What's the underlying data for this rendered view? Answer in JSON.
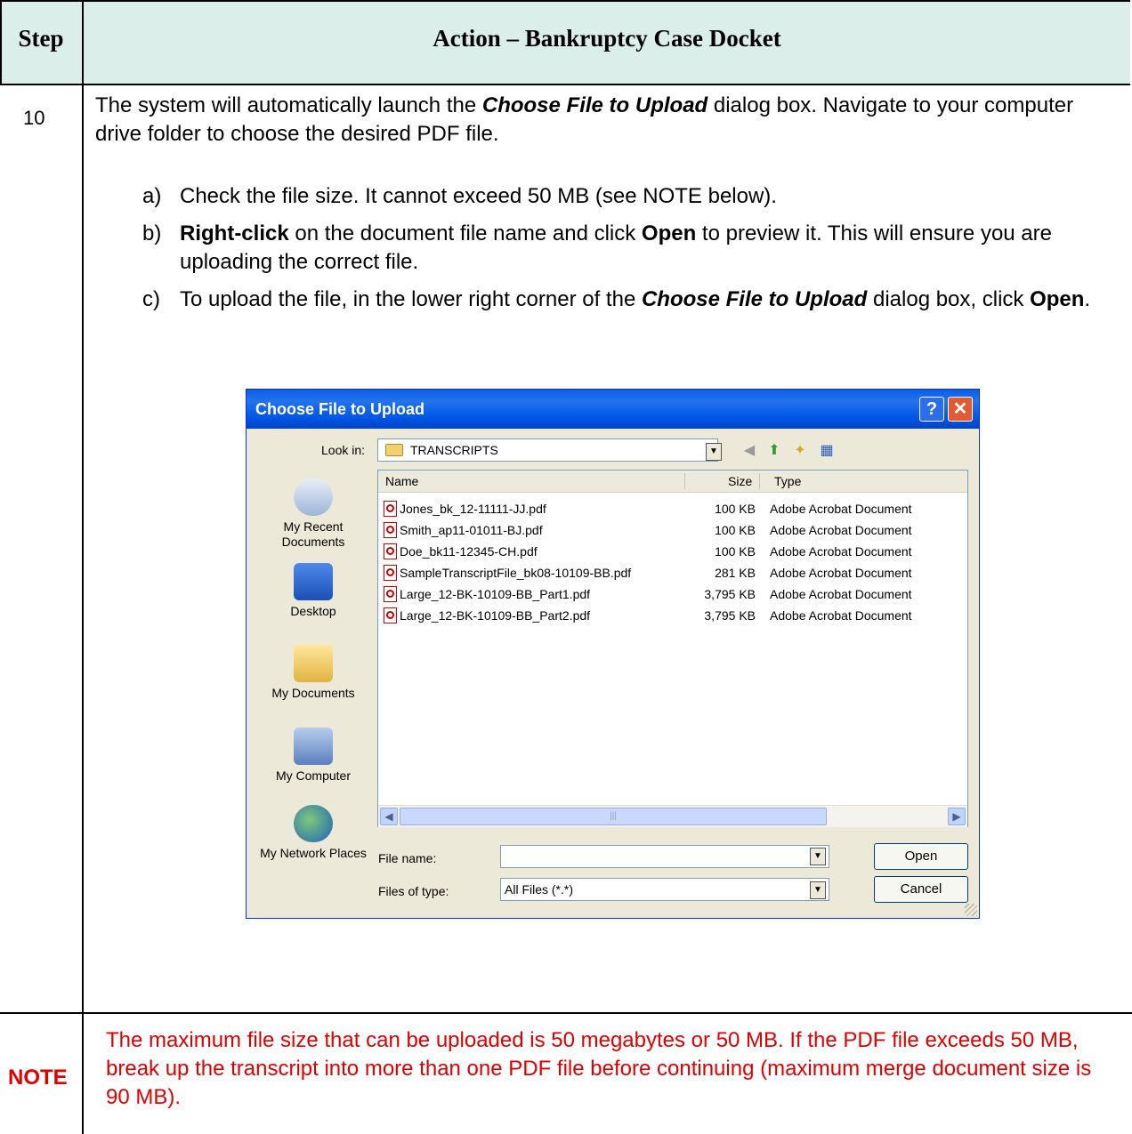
{
  "header": {
    "step_label": "Step",
    "action_label": "Action – Bankruptcy Case Docket"
  },
  "step": {
    "number": "10",
    "intro_1": "The system will automatically launch the ",
    "intro_em": "Choose File to Upload",
    "intro_2": " dialog box. Navigate to your computer drive folder to choose the desired PDF file.",
    "items": [
      {
        "marker": "a)",
        "text": "Check the file size.  It cannot exceed 50 MB (see NOTE below)."
      },
      {
        "marker": "b)",
        "b1": "Right-click",
        "t1": " on the document file name and click ",
        "b2": "Open",
        "t2": " to preview it.  This will ensure you are uploading the correct file."
      },
      {
        "marker": "c)",
        "t1": "To upload the file, in the lower right corner of the ",
        "em": "Choose File to Upload",
        "t2": " dialog box, click ",
        "b": "Open",
        "t3": "."
      }
    ]
  },
  "dialog": {
    "title": "Choose File to Upload",
    "help_icon": "?",
    "close_icon": "✕",
    "look_in_label": "Look in:",
    "look_in_value": "TRANSCRIPTS",
    "places": [
      "My Recent Documents",
      "Desktop",
      "My Documents",
      "My Computer",
      "My Network Places"
    ],
    "columns": {
      "name": "Name",
      "size": "Size",
      "type": "Type"
    },
    "files": [
      {
        "name": "Jones_bk_12-11111-JJ.pdf",
        "size": "100 KB",
        "type": "Adobe Acrobat Document"
      },
      {
        "name": "Smith_ap11-01011-BJ.pdf",
        "size": "100 KB",
        "type": "Adobe Acrobat Document"
      },
      {
        "name": "Doe_bk11-12345-CH.pdf",
        "size": "100 KB",
        "type": "Adobe Acrobat Document"
      },
      {
        "name": "SampleTranscriptFile_bk08-10109-BB.pdf",
        "size": "281 KB",
        "type": "Adobe Acrobat Document"
      },
      {
        "name": "Large_12-BK-10109-BB_Part1.pdf",
        "size": "3,795 KB",
        "type": "Adobe Acrobat Document"
      },
      {
        "name": "Large_12-BK-10109-BB_Part2.pdf",
        "size": "3,795 KB",
        "type": "Adobe Acrobat Document"
      }
    ],
    "file_name_label": "File name:",
    "file_name_value": "",
    "files_of_type_label": "Files of type:",
    "files_of_type_value": "All Files (*.*)",
    "open_button": "Open",
    "cancel_button": "Cancel"
  },
  "note": {
    "label": "NOTE",
    "text": "The maximum file size that can be uploaded is 50 megabytes or 50 MB.  If the PDF file exceeds 50 MB, break up the transcript into more than one PDF file before continuing (maximum merge document size is 90 MB)."
  },
  "colors": {
    "note_red": "#e00000",
    "header_fill": "#dbeeea",
    "titlebar_blue": "#0058e6"
  }
}
